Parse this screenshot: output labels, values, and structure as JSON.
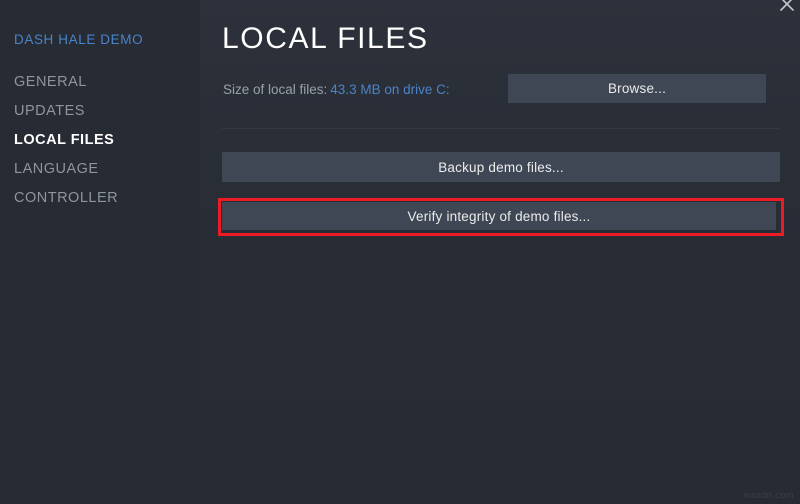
{
  "window": {
    "close_icon": "close-icon"
  },
  "sidebar": {
    "game_title": "DASH HALE DEMO",
    "items": [
      {
        "label": "GENERAL",
        "active": false
      },
      {
        "label": "UPDATES",
        "active": false
      },
      {
        "label": "LOCAL FILES",
        "active": true
      },
      {
        "label": "LANGUAGE",
        "active": false
      },
      {
        "label": "CONTROLLER",
        "active": false
      }
    ]
  },
  "main": {
    "page_title": "LOCAL FILES",
    "size_label": "Size of local files:",
    "size_value": "43.3 MB on drive C:",
    "browse_label": "Browse...",
    "backup_label": "Backup demo files...",
    "verify_label": "Verify integrity of demo files..."
  },
  "watermark": {
    "text": "wsxdn.com"
  },
  "colors": {
    "sidebar_bg": "#272b33",
    "main_bg": "#282c35",
    "accent_blue": "#4a83c9",
    "button_fill": "#3f4755",
    "highlight_red": "#ed1c24",
    "text_muted": "#8f949d",
    "text_active": "#ffffff"
  }
}
